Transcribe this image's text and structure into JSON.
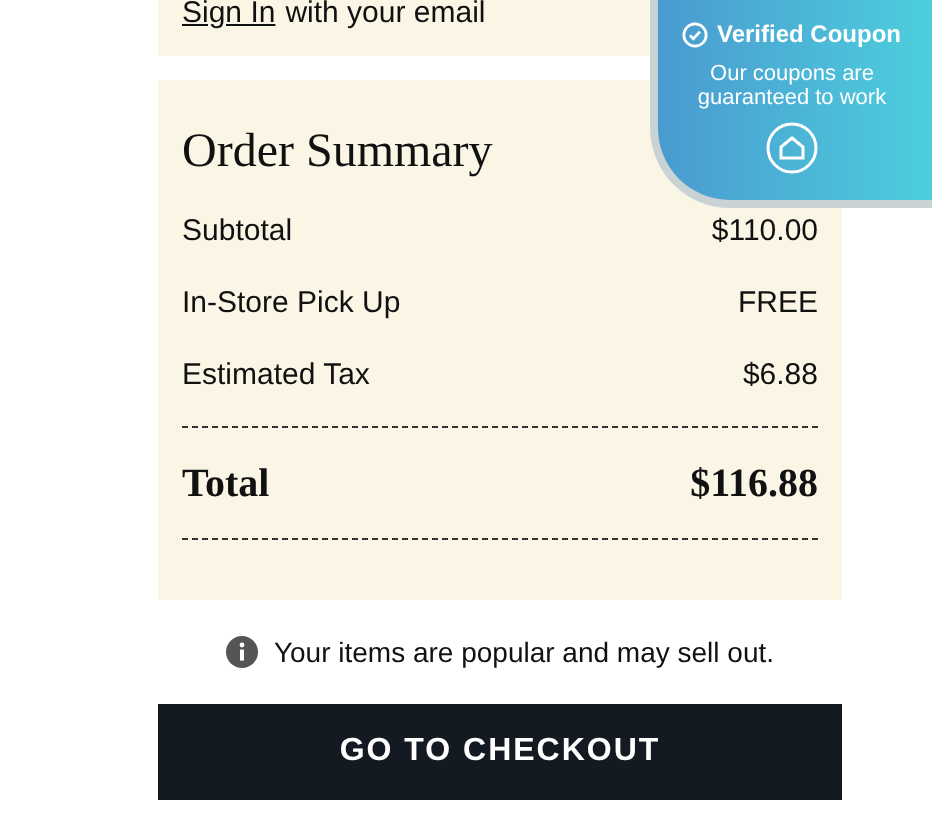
{
  "sign_in": {
    "link": "Sign In",
    "text": "with your email"
  },
  "order_summary": {
    "title": "Order Summary",
    "rows": [
      {
        "label": "Subtotal",
        "value": "$110.00"
      },
      {
        "label": "In-Store Pick Up",
        "value": "FREE"
      },
      {
        "label": "Estimated Tax",
        "value": "$6.88"
      }
    ],
    "total": {
      "label": "Total",
      "value": "$116.88"
    }
  },
  "notice": "Your items are popular and may sell out.",
  "checkout_button": "GO TO CHECKOUT",
  "coupon_badge": {
    "title": "Verified Coupon",
    "text": "Our coupons are guaranteed to work"
  }
}
